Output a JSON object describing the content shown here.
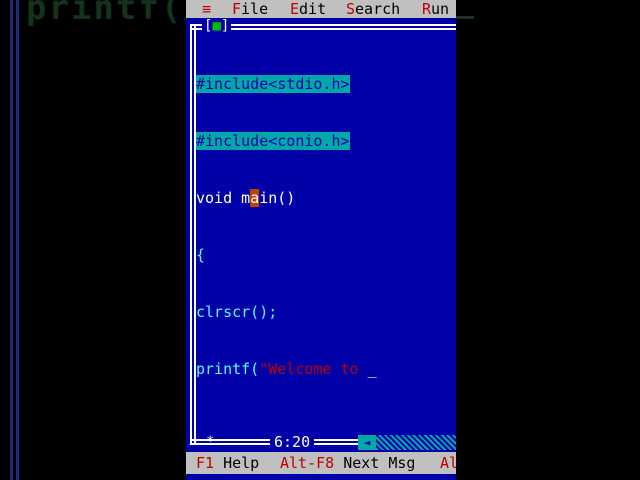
{
  "background": {
    "ghost_text": "printf("
  },
  "menubar": {
    "system_menu": "≡",
    "items": [
      {
        "hot": "F",
        "rest": "ile"
      },
      {
        "hot": "E",
        "rest": "dit"
      },
      {
        "hot": "S",
        "rest": "earch"
      },
      {
        "hot": "R",
        "rest": "un"
      }
    ]
  },
  "window": {
    "close_box_left": "[",
    "close_box_mark": "■",
    "close_box_right": "]"
  },
  "editor": {
    "lines": [
      "#include<stdio.h>",
      "#include<conio.h>",
      "void main()",
      "{",
      "clrscr();",
      "printf(\"Welcome to "
    ],
    "line3": {
      "pre": "void m",
      "cursor_char": "a",
      "post": "in()"
    },
    "line6": {
      "fn": "printf(",
      "str": "\"Welcome to ",
      "caret": "_"
    }
  },
  "status": {
    "modified_marker": "*",
    "position": "6:20",
    "scroll_arrow": "◄"
  },
  "hotkeys": [
    {
      "key": "F1",
      "label": " Help"
    },
    {
      "key": "Alt-F8",
      "label": " Next Msg"
    },
    {
      "key": "Al",
      "label": ""
    }
  ],
  "colors": {
    "editor_bg": "#0000a8",
    "menu_bg": "#c0c0c0",
    "hotkey": "#c00000",
    "highlight": "#00a8a8",
    "string": "#c00000"
  }
}
